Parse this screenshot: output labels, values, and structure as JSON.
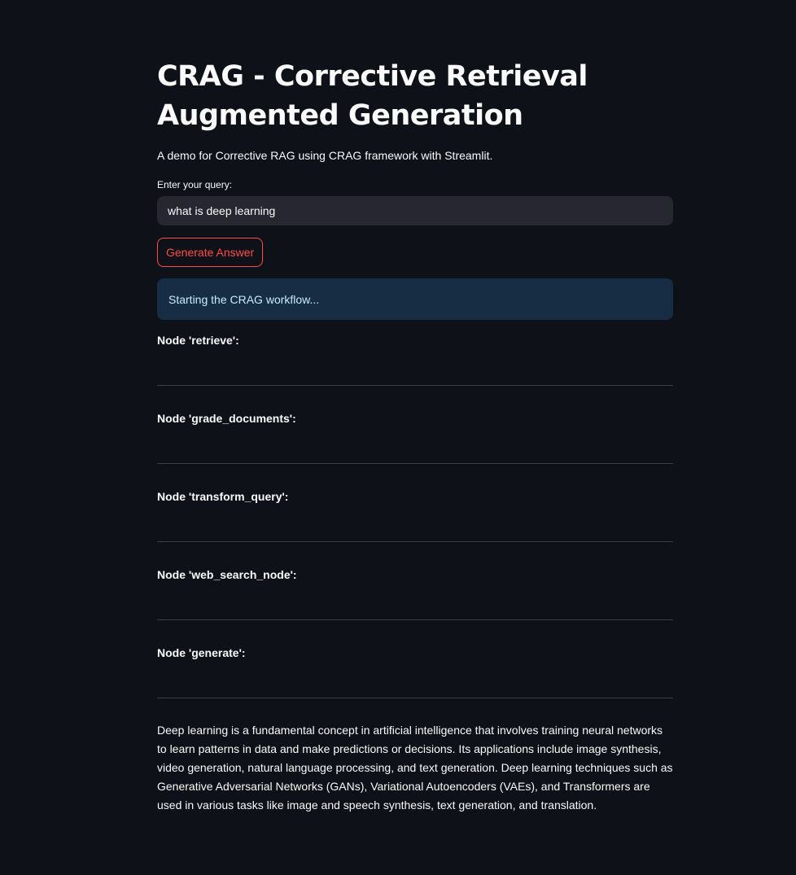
{
  "app": {
    "title": "CRAG - Corrective Retrieval Augmented Generation",
    "subtitle": "A demo for Corrective RAG using CRAG framework with Streamlit."
  },
  "query": {
    "label": "Enter your query:",
    "value": "what is deep learning"
  },
  "actions": {
    "generate_label": "Generate Answer"
  },
  "status": {
    "info": "Starting the CRAG workflow..."
  },
  "nodes": [
    {
      "label": "Node 'retrieve':"
    },
    {
      "label": "Node 'grade_documents':"
    },
    {
      "label": "Node 'transform_query':"
    },
    {
      "label": "Node 'web_search_node':"
    },
    {
      "label": "Node 'generate':"
    }
  ],
  "answer": {
    "text": "Deep learning is a fundamental concept in artificial intelligence that involves training neural networks to learn patterns in data and make predictions or decisions. Its applications include image synthesis, video generation, natural language processing, and text generation. Deep learning techniques such as Generative Adversarial Networks (GANs), Variational Autoencoders (VAEs), and Transformers are used in various tasks like image and speech synthesis, text generation, and translation."
  },
  "colors": {
    "background": "#0e1117",
    "input_bg": "#262730",
    "accent": "#ff4b4b",
    "info_bg": "#172d43",
    "info_text": "#c7ebff",
    "divider": "#3a3d46"
  }
}
